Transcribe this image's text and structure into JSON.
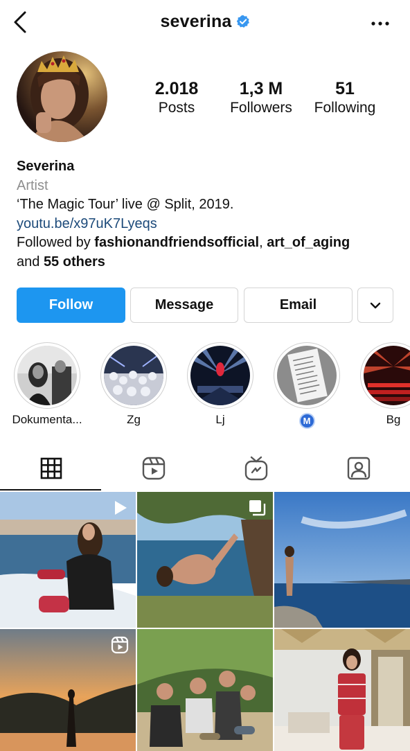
{
  "header": {
    "username": "severina",
    "verified": true,
    "back_icon": "chevron-left-icon",
    "more_icon": "more-horizontal-icon"
  },
  "stats": [
    {
      "value": "2.018",
      "label": "Posts"
    },
    {
      "value": "1,3 M",
      "label": "Followers"
    },
    {
      "value": "51",
      "label": "Following"
    }
  ],
  "bio": {
    "name": "Severina",
    "category": "Artist",
    "text": "‘The Magic Tour’ live @ Split, 2019.",
    "link": "youtu.be/x97uK7Lyeqs",
    "followed_by_prefix": "Followed by ",
    "followed_by_1": "fashionandfriendsofficial",
    "followed_by_sep": ", ",
    "followed_by_2": "art_of_aging",
    "followed_by_and": "and ",
    "followed_by_others": "55 others"
  },
  "actions": {
    "follow": "Follow",
    "message": "Message",
    "email": "Email",
    "dropdown_icon": "chevron-down-icon"
  },
  "highlights": [
    {
      "label": "Dokumenta..."
    },
    {
      "label": "Zg"
    },
    {
      "label": "Lj"
    },
    {
      "label": "M",
      "is_badge": true
    },
    {
      "label": "Bg"
    }
  ],
  "tabs": [
    {
      "name": "posts-grid",
      "icon": "grid-icon",
      "active": true
    },
    {
      "name": "reels",
      "icon": "reels-icon",
      "active": false
    },
    {
      "name": "igtv",
      "icon": "igtv-icon",
      "active": false
    },
    {
      "name": "tagged",
      "icon": "tagged-person-icon",
      "active": false
    }
  ],
  "posts": [
    {
      "badge": "reel-play-icon"
    },
    {
      "badge": "multiple-photos-icon"
    },
    {
      "badge": ""
    },
    {
      "badge": "reels-icon"
    },
    {
      "badge": ""
    },
    {
      "badge": ""
    }
  ],
  "colors": {
    "follow_button": "#1d96f0",
    "link": "#1c4a7a",
    "verified": "#3897f0",
    "muted_text": "#8e8e8e"
  }
}
